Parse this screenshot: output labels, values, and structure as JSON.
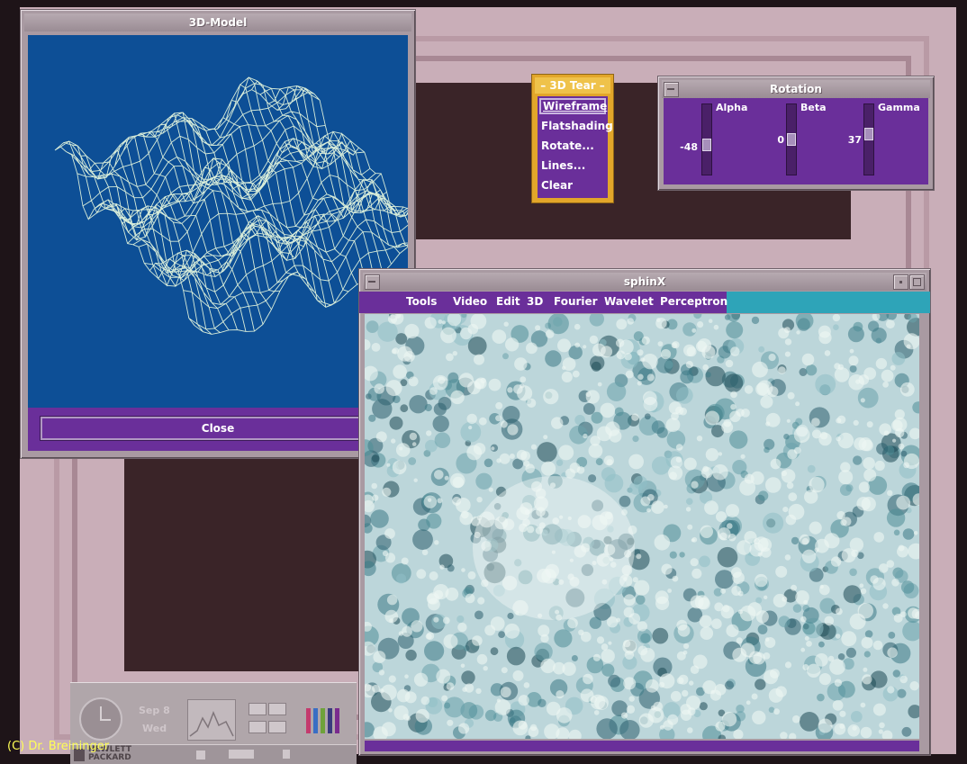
{
  "model_window": {
    "title": "3D-Model",
    "close_label": "Close"
  },
  "tear_menu": {
    "title": "3D Tear",
    "items": [
      "Wireframe",
      "Flatshading",
      "Rotate...",
      "Lines...",
      "Clear"
    ],
    "selected": "Wireframe"
  },
  "rotation": {
    "title": "Rotation",
    "sliders": [
      {
        "label": "Alpha",
        "value": "-48"
      },
      {
        "label": "Beta",
        "value": "0"
      },
      {
        "label": "Gamma",
        "value": "37"
      }
    ]
  },
  "sphinx": {
    "title": "sphinX",
    "menus": [
      "Tools",
      "Video",
      "Edit",
      "3D",
      "Fourier",
      "Wavelet",
      "Perceptron"
    ]
  },
  "hp_panel": {
    "date": "Sep 8",
    "day": "Wed",
    "brand_line1": "HEWLETT",
    "brand_line2": "PACKARD"
  },
  "watermark": "(C) Dr. Breininger",
  "colors": {
    "accent_purple": "#6a2f9a",
    "canvas_blue": "#0d4f96",
    "menubar_cyan": "#2ea4b8",
    "tear_orange": "#e2a62a"
  }
}
